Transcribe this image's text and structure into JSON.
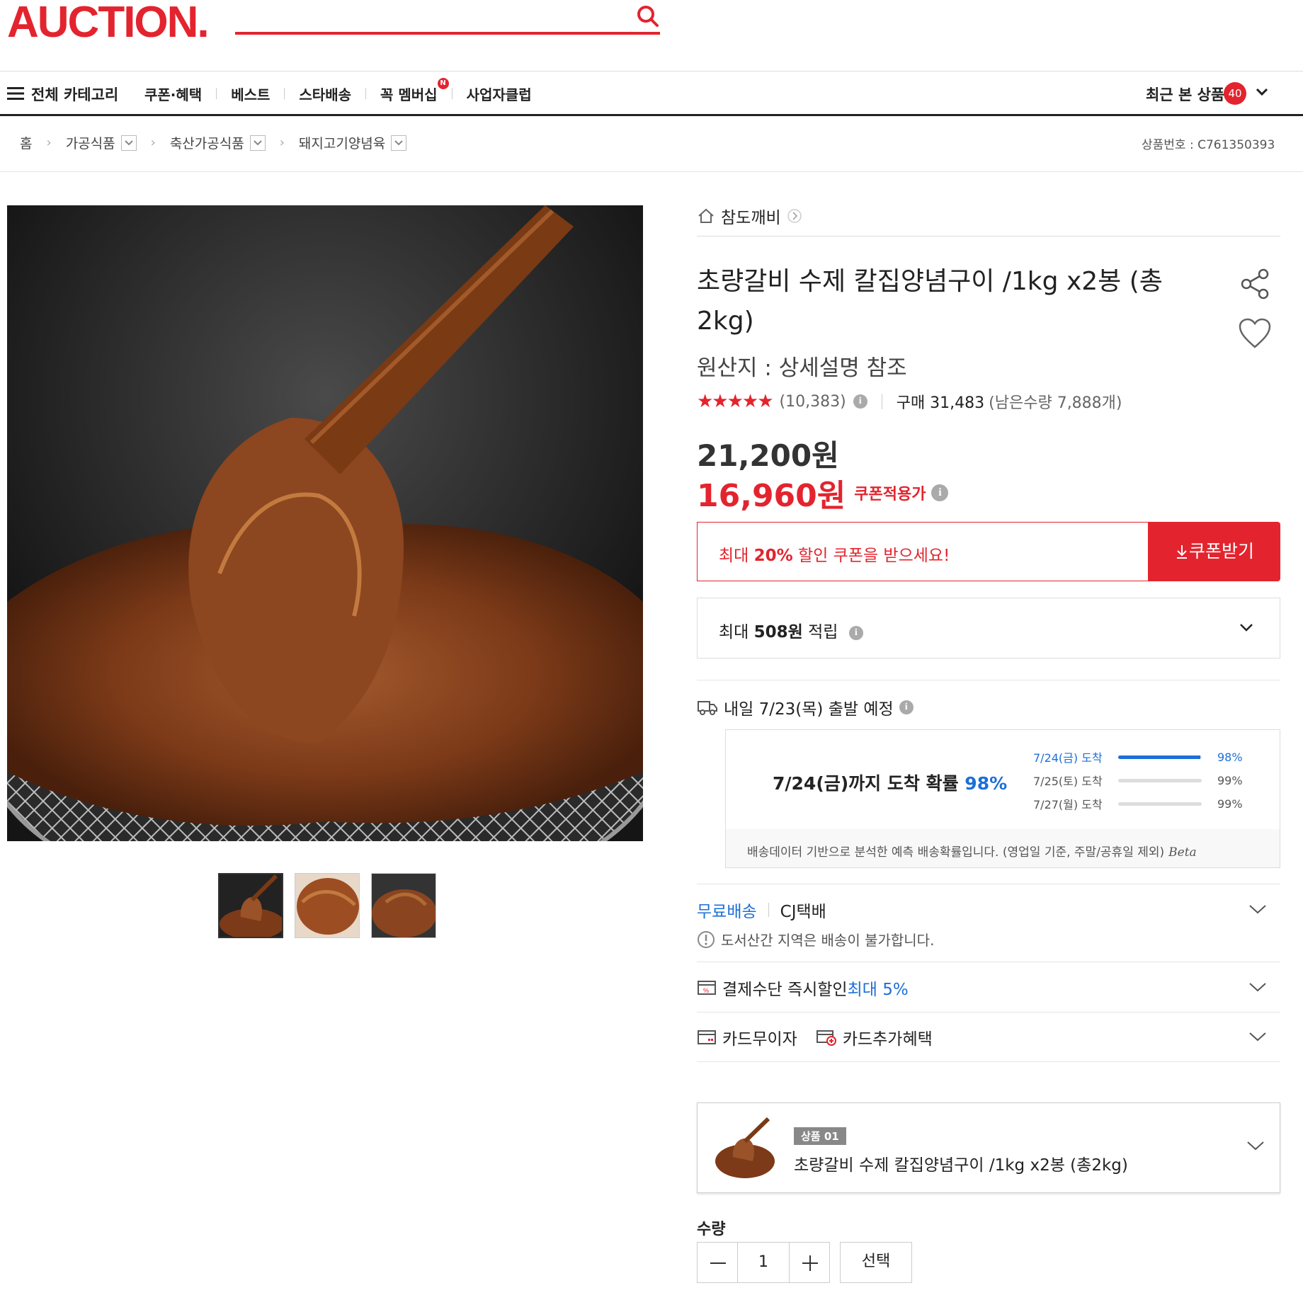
{
  "header": {
    "logo": "AUCTION."
  },
  "nav": {
    "all_categories": "전체 카테고리",
    "links": [
      "쿠폰·혜택",
      "베스트",
      "스타배송",
      "꼭 멤버십",
      "사업자클럽"
    ],
    "membership_badge": "N",
    "recent_label": "최근 본 상품",
    "recent_count": "40"
  },
  "breadcrumb": {
    "home": "홈",
    "items": [
      "가공식품",
      "축산가공식품",
      "돼지고기양념육"
    ],
    "product_no": "상품번호 : C761350393"
  },
  "product": {
    "store": "참도깨비",
    "title": "초량갈비 수제 칼집양념구이 /1kg x2봉 (총2kg)",
    "origin": "원산지 : 상세설명 참조",
    "rating_stars": 4.5,
    "review_count": "(10,383)",
    "purchases": "구매 31,483",
    "remaining": "(남은수량 7,888개)",
    "price": "21,200원",
    "coupon_price": "16,960원",
    "coupon_price_label": "쿠폰적용가"
  },
  "coupon": {
    "msg_prefix": "최대 ",
    "msg_bold": "20%",
    "msg_suffix": " 할인 쿠폰을 받으세요!",
    "button": "쿠폰받기"
  },
  "points": {
    "prefix": "최대 ",
    "bold": "508원",
    "suffix": " 적립"
  },
  "shipping": {
    "schedule": "내일 7/23(목) 출발 예정",
    "prob_main": "7/24(금)까지 도착 확률",
    "prob_main_value": "98%",
    "rows": [
      {
        "date": "7/24(금) 도착",
        "pct": "98%",
        "fill": 0.98
      },
      {
        "date": "7/25(토) 도착",
        "pct": "99%",
        "fill": 0
      },
      {
        "date": "7/27(월) 도착",
        "pct": "99%",
        "fill": 0
      }
    ],
    "note": "배송데이터 기반으로 분석한 예측 배송확률입니다. (영업일 기준, 주말/공휴일 제외)",
    "beta": "Beta"
  },
  "delivery": {
    "free": "무료배송",
    "carrier": "CJ택배",
    "island_notice": "도서산간 지역은 배송이 불가합니다."
  },
  "payment": {
    "label": "결제수단 즉시할인 ",
    "highlight": "최대 5%"
  },
  "cards": {
    "interest_free": "카드무이자",
    "extra": "카드추가혜택"
  },
  "option": {
    "tag": "상품 01",
    "name": "초량갈비 수제 칼집양념구이 /1kg x2봉 (총2kg)"
  },
  "quantity": {
    "label": "수량",
    "value": "1",
    "select": "선택"
  },
  "colors": {
    "brand_red": "#e3242e",
    "accent_blue": "#1d6fd8"
  }
}
